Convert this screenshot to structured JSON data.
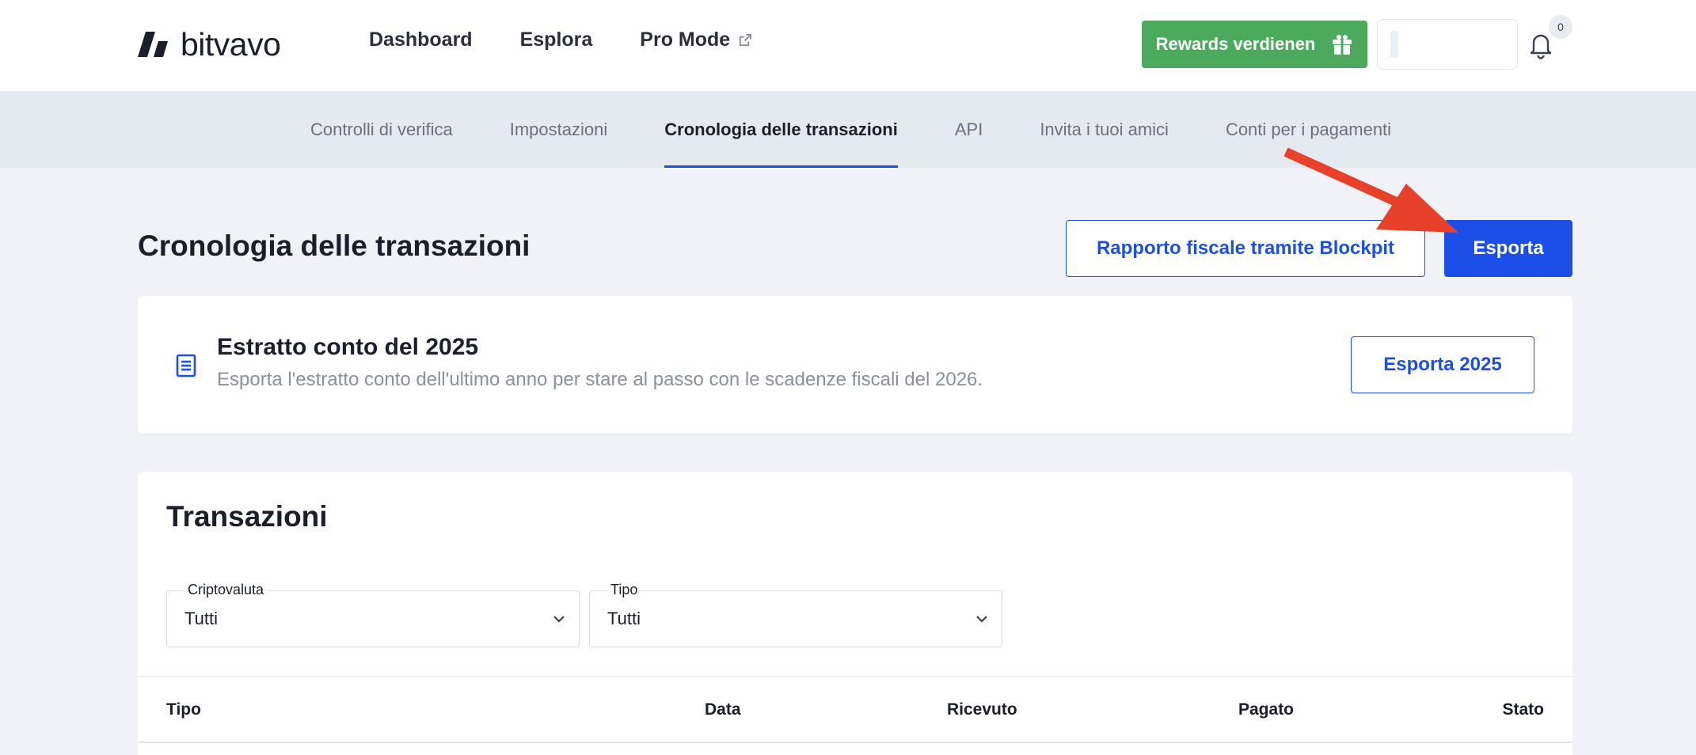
{
  "brand": {
    "name": "bitvavo",
    "accent": "#1c4fe8",
    "green": "#4caa5e"
  },
  "nav": {
    "items": [
      {
        "label": "Dashboard"
      },
      {
        "label": "Esplora"
      },
      {
        "label": "Pro Mode",
        "icon": "external-link-icon"
      }
    ]
  },
  "header": {
    "rewards_label": "Rewards verdienen",
    "rewards_icon": "gift-icon",
    "notifications_count": "0"
  },
  "subnav": {
    "tabs": [
      {
        "label": "Controlli di verifica"
      },
      {
        "label": "Impostazioni"
      },
      {
        "label": "Cronologia delle transazioni",
        "active": true
      },
      {
        "label": "API"
      },
      {
        "label": "Invita i tuoi amici"
      },
      {
        "label": "Conti per i pagamenti"
      }
    ]
  },
  "page": {
    "title": "Cronologia delle transazioni",
    "tax_report_label": "Rapporto fiscale tramite Blockpit",
    "export_label": "Esporta"
  },
  "statement": {
    "title": "Estratto conto del 2025",
    "subtitle": "Esporta l'estratto conto dell'ultimo anno per stare al passo con le scadenze fiscali del 2026.",
    "export_label": "Esporta 2025"
  },
  "transactions": {
    "title": "Transazioni",
    "filters": [
      {
        "label": "Criptovaluta",
        "value": "Tutti"
      },
      {
        "label": "Tipo",
        "value": "Tutti"
      }
    ],
    "columns": [
      "Tipo",
      "Data",
      "Ricevuto",
      "Pagato",
      "Stato"
    ]
  }
}
